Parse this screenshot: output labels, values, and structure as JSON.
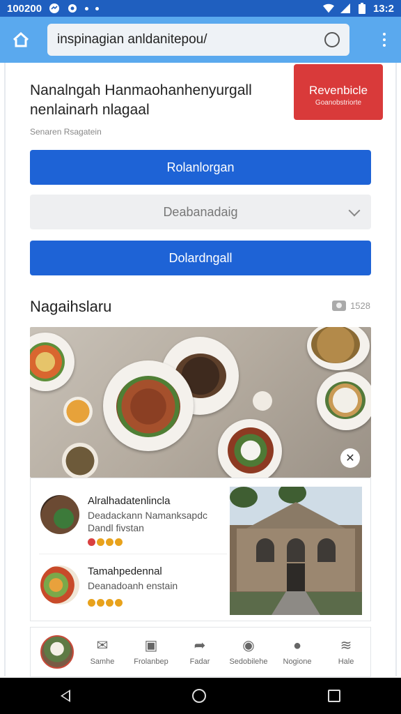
{
  "status_bar": {
    "time_left": "100200",
    "time_right": "13:2"
  },
  "browser": {
    "url": "inspinagian anldanitepou/"
  },
  "headline": {
    "line1": "Nanalngah Hanmaohanhenyurgall",
    "line2": "nenlainarh nlagaal"
  },
  "promo": {
    "title": "Revenbicle",
    "subtitle": "Goanobstriorte"
  },
  "meta": {
    "text": "Senaren Rsagatein"
  },
  "buttons": {
    "primary1": "Rolanlorgan",
    "select_value": "Deabanadaig",
    "primary2": "Dolardngall"
  },
  "section": {
    "title": "Nagaihslaru",
    "count": "1528"
  },
  "list": [
    {
      "title": "Alralhadatenlincla",
      "desc_line1": "Deadackann Namanksapdc",
      "desc_line2": "Dandl fivstan"
    },
    {
      "title": "Tamahpedennal",
      "desc_line1": "Deanadoanh enstain",
      "desc_line2": ""
    }
  ],
  "app_nav": [
    {
      "label": "Samhe",
      "icon": "mail-icon"
    },
    {
      "label": "Frolanbep",
      "icon": "calendar-icon"
    },
    {
      "label": "Fadar",
      "icon": "share-icon"
    },
    {
      "label": "Sedobilehe",
      "icon": "chat-icon"
    },
    {
      "label": "Nogione",
      "icon": "compass-icon"
    },
    {
      "label": "Hale",
      "icon": "layers-icon"
    }
  ]
}
